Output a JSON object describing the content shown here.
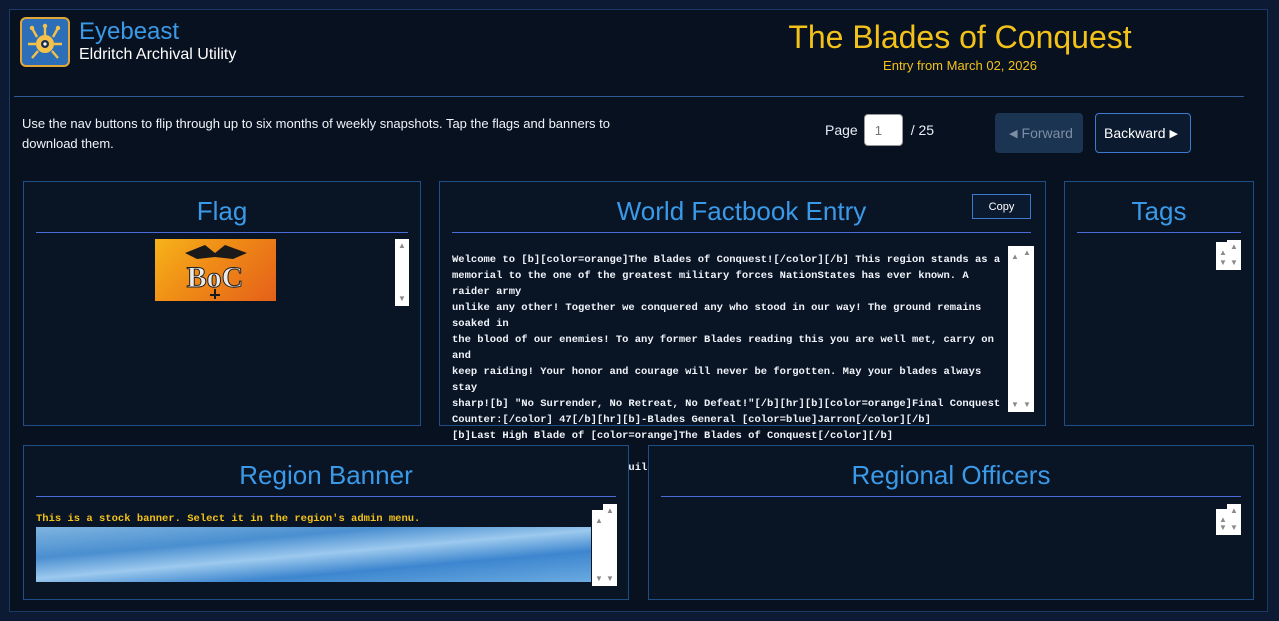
{
  "brand": {
    "name": "Eyebeast",
    "subtitle": "Eldritch Archival Utility"
  },
  "header": {
    "title": "The Blades of Conquest",
    "entry_date": "Entry from March 02, 2026"
  },
  "intro": "Use the nav buttons to flip through up to six months of weekly snapshots. Tap the flags and banners to download them.",
  "pager": {
    "label": "Page",
    "placeholder": "1",
    "total": "/ 25"
  },
  "nav": {
    "forward": "Forward",
    "backward": "Backward"
  },
  "panels": {
    "flag": {
      "title": "Flag",
      "flag_text": "BoC"
    },
    "factbook": {
      "title": "World Factbook Entry",
      "copy_label": "Copy",
      "text": "Welcome to [b][color=orange]The Blades of Conquest![/color][/b] This region stands as a\nmemorial to the one of the greatest military forces NationStates has ever known. A raider army\nunlike any other! Together we conquered any who stood in our way! The ground remains soaked in\nthe blood of our enemies! To any former Blades reading this you are well met, carry on and\nkeep raiding! Your honor and courage will never be forgotten. May your blades always stay\nsharp![b] \"No Surrender, No Retreat, No Defeat!\"[/b][hr][b][color=orange]Final Conquest\nCounter:[/color] 47[/b][hr][b]-Blades General [color=blue]Jarron[/color][/b]\n[b]Last High Blade of [color=orange]The Blades of Conquest[/color][/b]\n\nTime to stand tall we will build this region back up what it was at its greatest."
    },
    "tags": {
      "title": "Tags"
    },
    "banner": {
      "title": "Region Banner",
      "note": "This is a stock banner. Select it in the region's admin menu."
    },
    "officers": {
      "title": "Regional Officers"
    }
  },
  "colors": {
    "accent": "#3a9ae8",
    "title_gold": "#f2c21a",
    "background": "#08111f"
  }
}
